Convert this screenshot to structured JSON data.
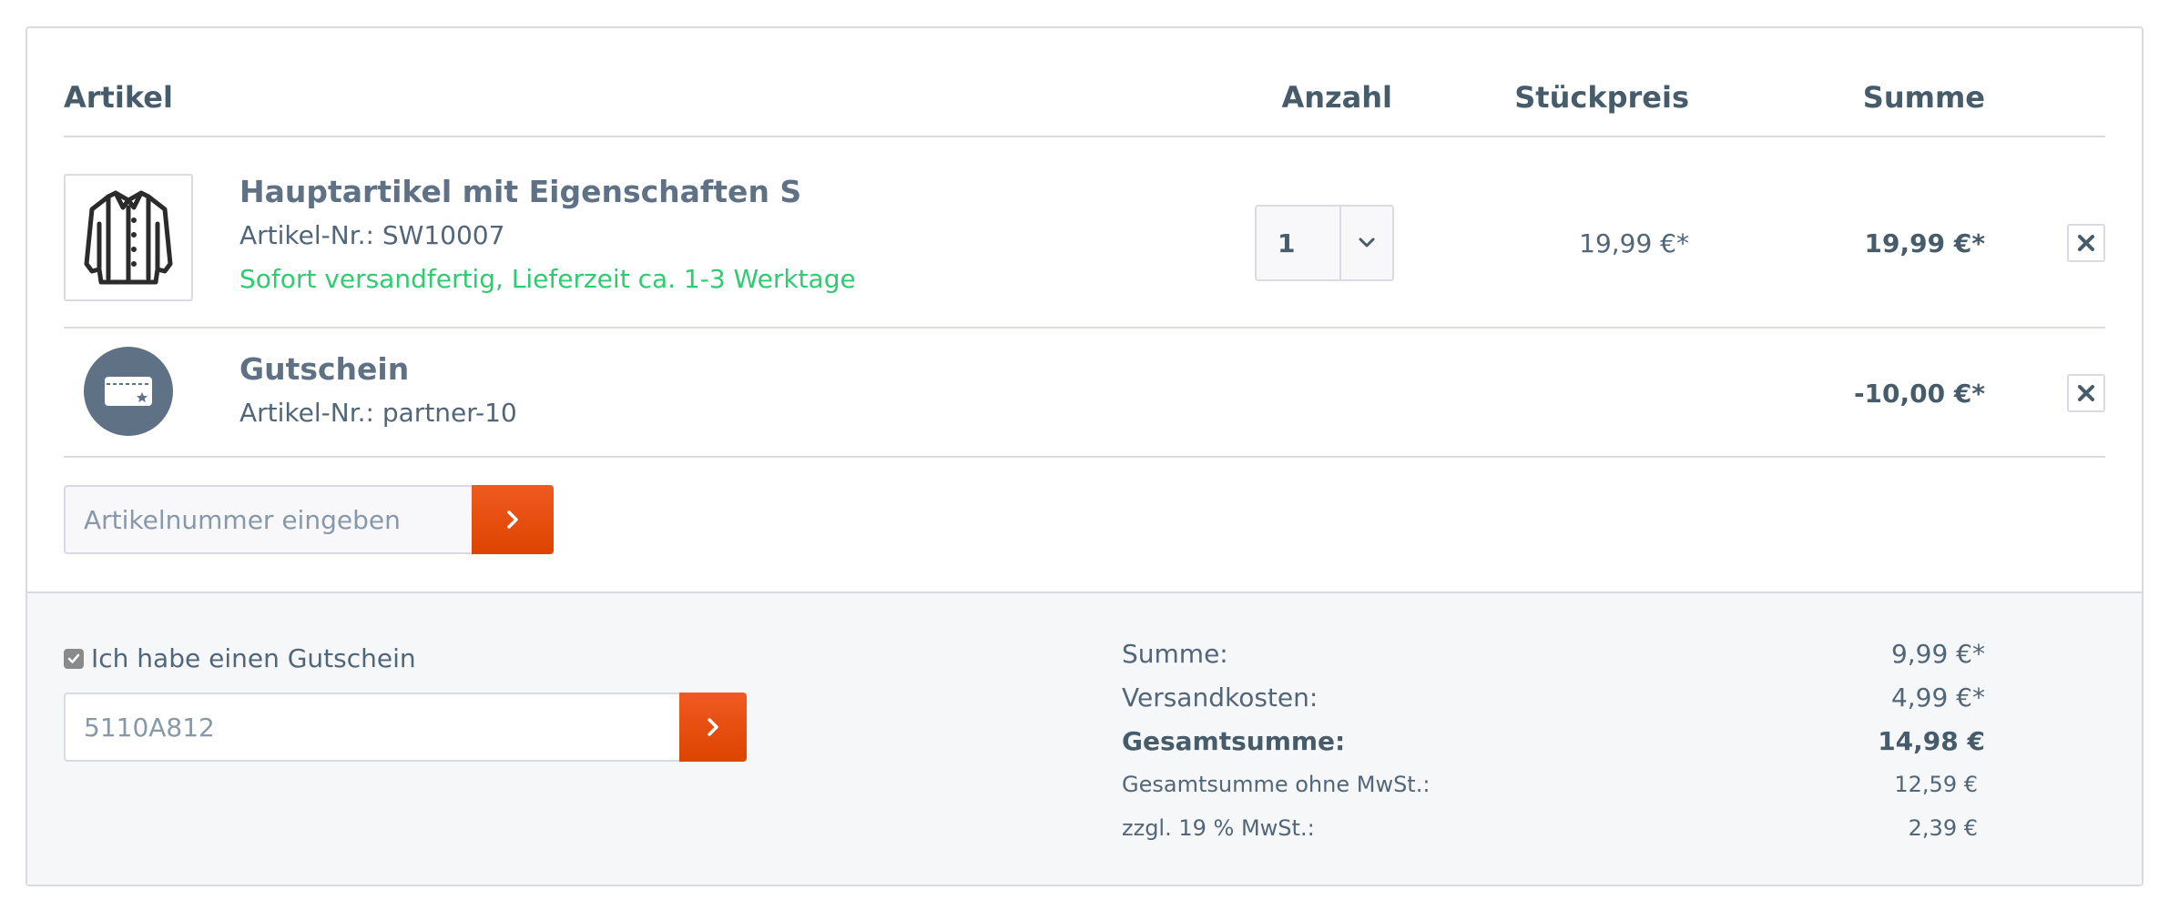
{
  "header": {
    "article": "Artikel",
    "quantity": "Anzahl",
    "unit_price": "Stückpreis",
    "total": "Summe"
  },
  "items": [
    {
      "name": "Hauptartikel mit Eigenschaften S",
      "sku": "Artikel-Nr.: SW10007",
      "delivery": "Sofort versandfertig, Lieferzeit ca. 1-3 Werktage",
      "quantity": "1",
      "unit_price": "19,99 €*",
      "total": "19,99 €*",
      "icon": "jacket-icon"
    },
    {
      "name": "Gutschein",
      "sku": "Artikel-Nr.: partner-10",
      "total": "-10,00 €*",
      "icon": "voucher-card-icon"
    }
  ],
  "add_product": {
    "placeholder": "Artikelnummer eingeben"
  },
  "voucher": {
    "checkbox_label": "Ich habe einen Gutschein",
    "checked": true,
    "code": "5110A812"
  },
  "summary": {
    "sum_label": "Summe:",
    "sum_value": "9,99 €*",
    "shipping_label": "Versandkosten:",
    "shipping_value": "4,99 €*",
    "grand_label": "Gesamtsumme:",
    "grand_value": "14,98 €",
    "net_label": "Gesamtsumme ohne MwSt.:",
    "net_value": "12,59 €",
    "vat_label": "zzgl. 19 % MwSt.:",
    "vat_value": "2,39 €"
  },
  "colors": {
    "accent": "#e84c1c",
    "delivery_green": "#2ecc71",
    "border": "#dadae5",
    "footer_bg": "#f6f7f9"
  }
}
